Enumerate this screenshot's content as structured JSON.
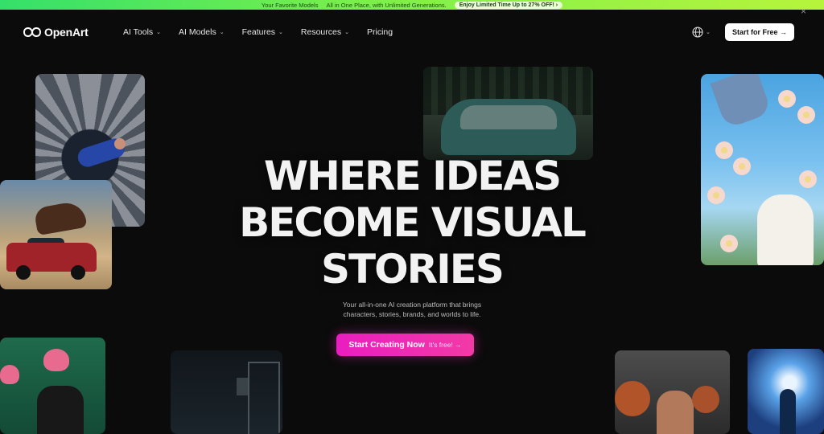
{
  "promo": {
    "text_1": "Your Favorite Models",
    "text_2": "All in One Place, with Unlimited Generations.",
    "offer": "Enjoy Limited Time Up to 27% OFF! ›",
    "close_glyph": "×"
  },
  "nav": {
    "logo_text": "OpenArt",
    "items": [
      {
        "label": "AI Tools",
        "chevron": "⌄"
      },
      {
        "label": "AI Models",
        "chevron": "⌄"
      },
      {
        "label": "Features",
        "chevron": "⌄"
      },
      {
        "label": "Resources",
        "chevron": "⌄"
      },
      {
        "label": "Pricing"
      }
    ],
    "language_chevron": "⌄",
    "start_free_label": "Start for Free →"
  },
  "hero": {
    "title_line_1": "WHERE IDEAS",
    "title_line_2": "BECOME VISUAL",
    "title_line_3": "STORIES",
    "subtitle_line_1": "Your all-in-one AI creation platform that brings",
    "subtitle_line_2": "characters, stories, brands, and worlds to life.",
    "cta_label": "Start Creating Now",
    "cta_note": "It's free! →"
  },
  "colors": {
    "banner_green": "#5fe84e",
    "cta_pink": "#ea1ec0",
    "background": "#0b0b0b"
  },
  "icons": {
    "logo": "infinity-logo-icon",
    "language": "globe-icon",
    "close": "close-icon"
  }
}
